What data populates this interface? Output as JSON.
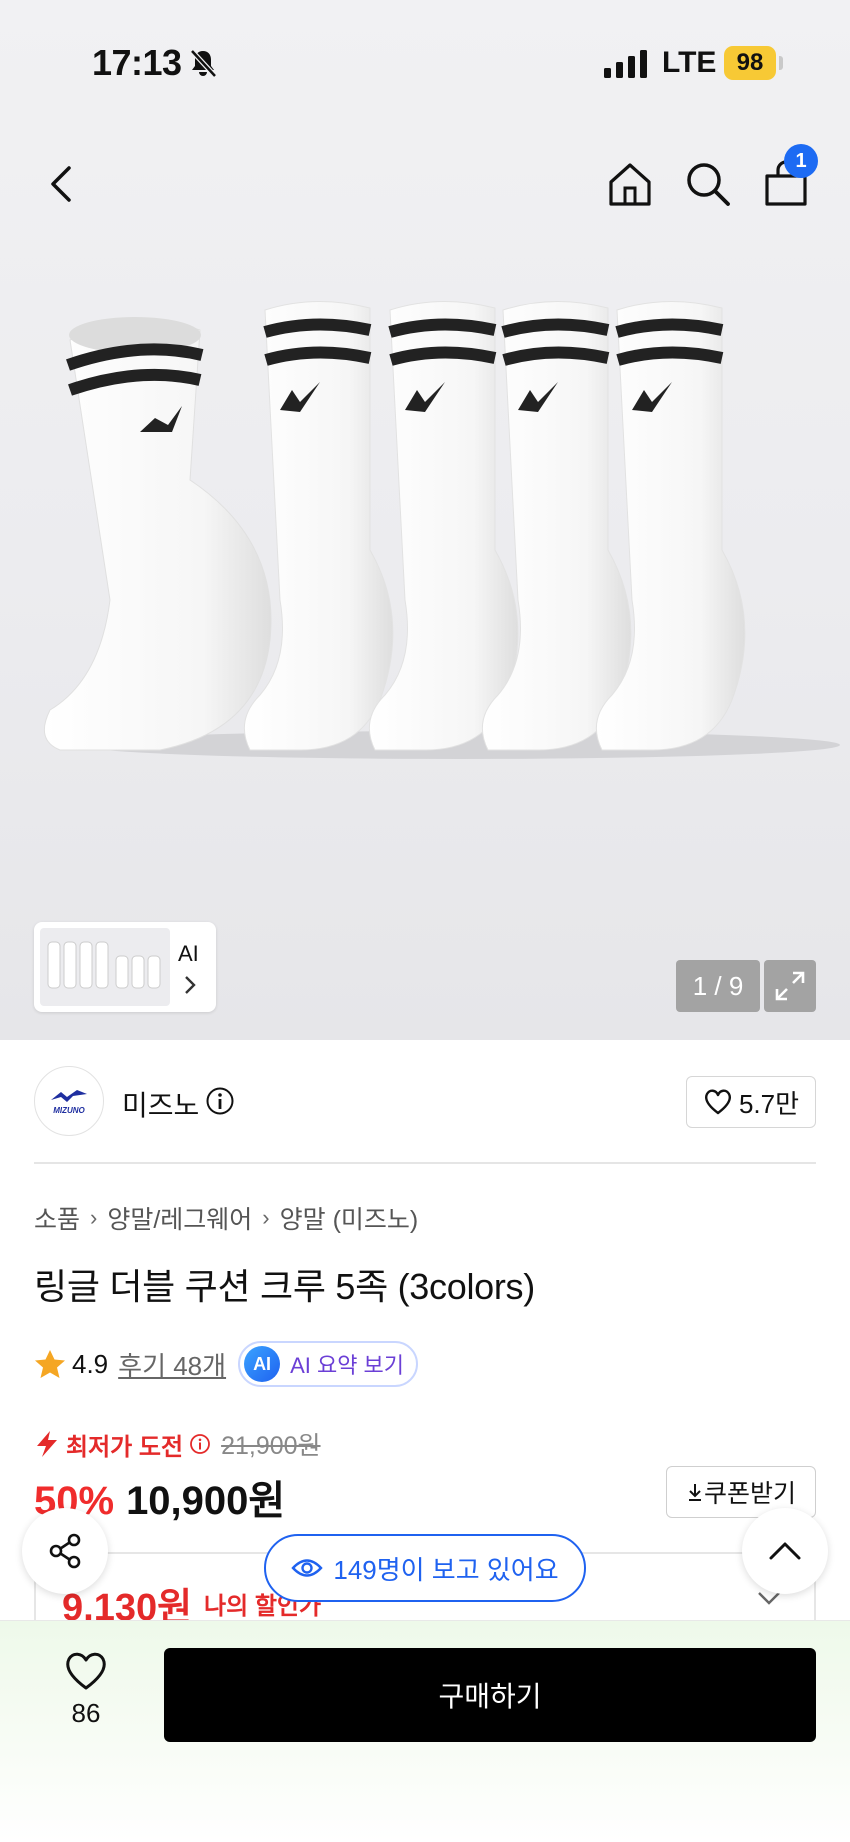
{
  "status_bar": {
    "time": "17:13",
    "network": "LTE",
    "battery": "98",
    "icons": [
      "bell-off-icon",
      "signal-icon"
    ]
  },
  "nav": {
    "cart_count": "1",
    "icons": [
      "back-icon",
      "home-icon",
      "search-icon",
      "cart-icon"
    ]
  },
  "gallery": {
    "ai_label": "AI",
    "counter": "1 / 9",
    "icons": [
      "chevron-right-icon",
      "expand-icon"
    ]
  },
  "brand": {
    "name": "미즈노",
    "logo_text": "MIZUNO",
    "likes": "5.7만",
    "icons": [
      "info-icon",
      "heart-icon"
    ]
  },
  "breadcrumb": [
    "소품",
    "양말/레그웨어",
    "양말 (미즈노)"
  ],
  "product": {
    "title": "링글 더블 쿠션 크루 5족 (3colors)"
  },
  "rating": {
    "score": "4.9",
    "reviews": "후기 48개",
    "ai_badge": "AI",
    "ai_summary": "AI 요약 보기"
  },
  "price": {
    "lowest_label": "최저가 도전",
    "original": "21,900원",
    "discount": "50%",
    "current": "10,900원",
    "coupon": "쿠폰받기",
    "my_price": "9,130원",
    "my_price_label": "나의 할인가",
    "accent": "#e42a2a"
  },
  "viewers": {
    "text": "149명이 보고 있어요"
  },
  "bottom": {
    "wish_count": "86",
    "buy_label": "구매하기"
  },
  "colors": {
    "primary_blue": "#1f62f0",
    "battery": "#f7c935",
    "black": "#000000"
  }
}
